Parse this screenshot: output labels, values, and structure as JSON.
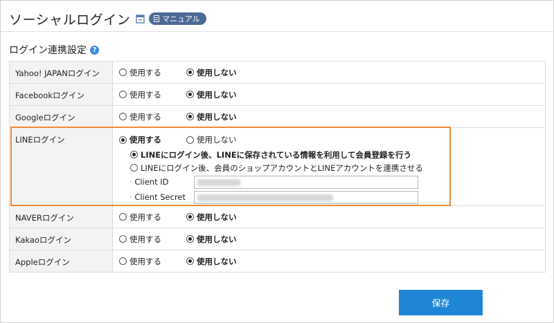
{
  "header": {
    "title": "ソーシャルログイン",
    "manual_label": "マニュアル"
  },
  "section": {
    "title": "ログイン連携設定"
  },
  "options": {
    "use": "使用する",
    "not_use": "使用しない"
  },
  "rows": [
    {
      "label": "Yahoo! JAPANログイン",
      "selected": "not_use"
    },
    {
      "label": "Facebookログイン",
      "selected": "not_use"
    },
    {
      "label": "Googleログイン",
      "selected": "not_use"
    },
    {
      "label": "LINEログイン",
      "selected": "use"
    },
    {
      "label": "NAVERログイン",
      "selected": "not_use"
    },
    {
      "label": "Kakaoログイン",
      "selected": "not_use"
    },
    {
      "label": "Appleログイン",
      "selected": "not_use"
    }
  ],
  "line_settings": {
    "mode_register": "LINEにログイン後、LINEに保存されている情報を利用して会員登録を行う",
    "mode_link": "LINEにログイン後、会員のショップアカウントとLINEアカウントを連携させる",
    "selected_mode": "register",
    "client_id_label": "Client ID",
    "client_secret_label": "Client Secret",
    "client_id_value": "",
    "client_secret_value": ""
  },
  "save_label": "保存",
  "colors": {
    "accent_blue": "#1f86d6",
    "manual_badge": "#4d6996",
    "highlight_orange": "#ef8a33",
    "help_icon": "#3a8be0"
  }
}
